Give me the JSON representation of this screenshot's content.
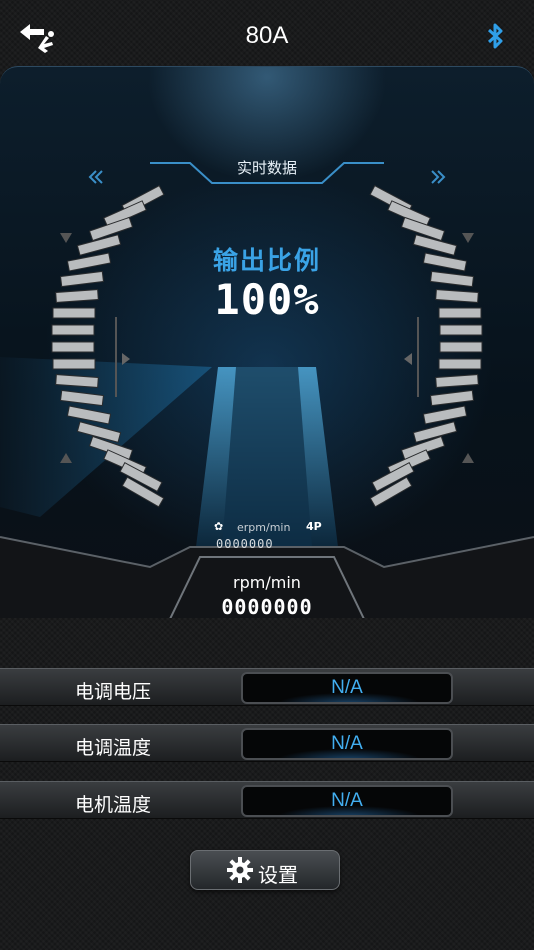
{
  "header": {
    "title": "80A",
    "back_icon": "back-arrow-plane-icon",
    "bluetooth_icon": "bluetooth-icon"
  },
  "gauge": {
    "tab_label": "实时数据",
    "output_ratio_label": "输出比例",
    "output_ratio_value": "100%",
    "erpm_unit": "erpm/min",
    "pole_count": "4P",
    "erpm_value": "0000000",
    "rpm_unit": "rpm/min",
    "rpm_value": "0000000"
  },
  "rows": [
    {
      "label": "电调电压",
      "value": "N/A"
    },
    {
      "label": "电调温度",
      "value": "N/A"
    },
    {
      "label": "电机温度",
      "value": "N/A"
    }
  ],
  "settings": {
    "label": "设置",
    "icon": "gear-icon"
  },
  "colors": {
    "accent": "#3aa3e6",
    "value_text": "#42aef0",
    "background": "#151617"
  }
}
